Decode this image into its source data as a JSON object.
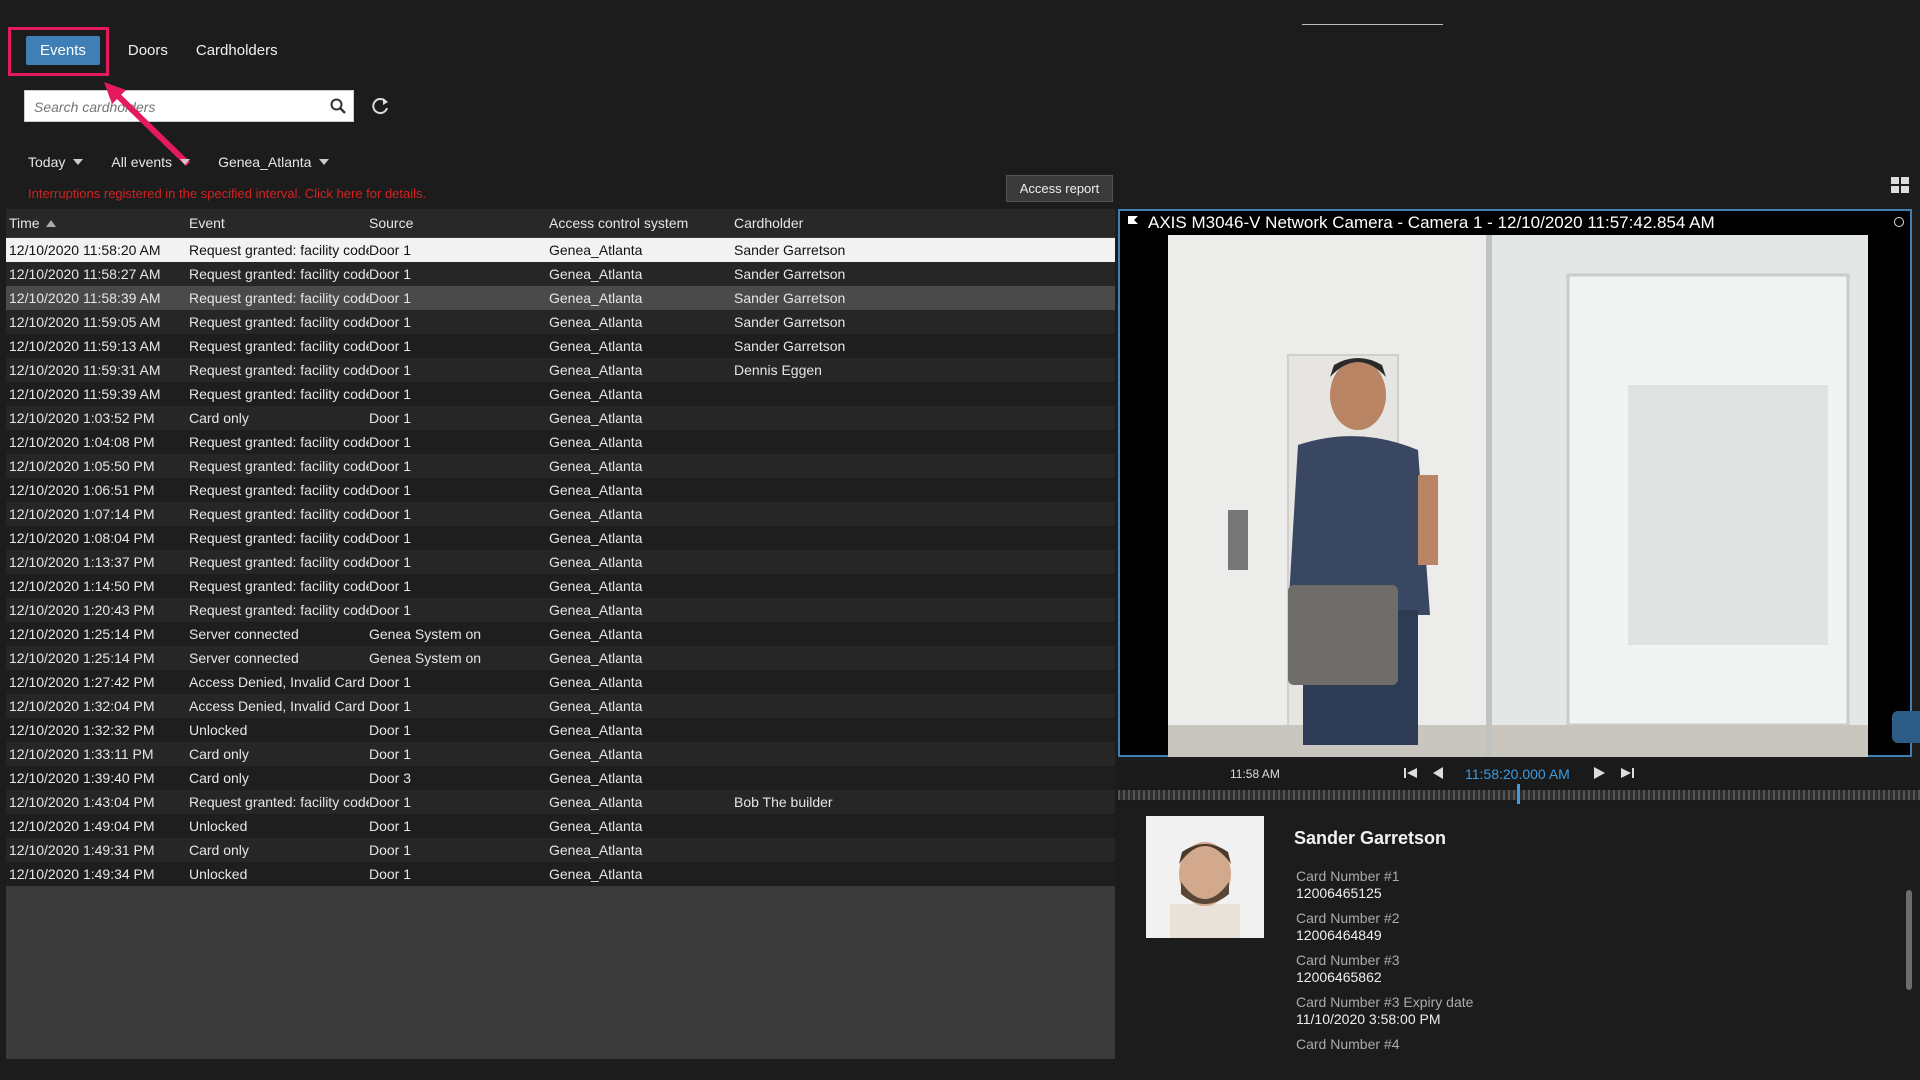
{
  "tabs": [
    {
      "label": "Events",
      "active": true
    },
    {
      "label": "Doors",
      "active": false
    },
    {
      "label": "Cardholders",
      "active": false
    }
  ],
  "search": {
    "placeholder": "Search cardholders",
    "value": ""
  },
  "filters": {
    "period": "Today",
    "events": "All events",
    "system": "Genea_Atlanta"
  },
  "warning": "Interruptions registered in the specified interval. Click here for details.",
  "access_report_label": "Access report",
  "table": {
    "columns": [
      "Time",
      "Event",
      "Source",
      "Access control system",
      "Cardholder"
    ],
    "rows": [
      [
        "12/10/2020 11:58:20 AM",
        "Request granted: facility code",
        "Door 1",
        "Genea_Atlanta",
        "Sander Garretson"
      ],
      [
        "12/10/2020 11:58:27 AM",
        "Request granted: facility code",
        "Door 1",
        "Genea_Atlanta",
        "Sander Garretson"
      ],
      [
        "12/10/2020 11:58:39 AM",
        "Request granted: facility code",
        "Door 1",
        "Genea_Atlanta",
        "Sander Garretson"
      ],
      [
        "12/10/2020 11:59:05 AM",
        "Request granted: facility code",
        "Door 1",
        "Genea_Atlanta",
        "Sander Garretson"
      ],
      [
        "12/10/2020 11:59:13 AM",
        "Request granted: facility code",
        "Door 1",
        "Genea_Atlanta",
        "Sander Garretson"
      ],
      [
        "12/10/2020 11:59:31 AM",
        "Request granted: facility code",
        "Door 1",
        "Genea_Atlanta",
        "Dennis Eggen"
      ],
      [
        "12/10/2020 11:59:39 AM",
        "Request granted: facility code",
        "Door 1",
        "Genea_Atlanta",
        ""
      ],
      [
        "12/10/2020 1:03:52 PM",
        "Card only",
        "Door 1",
        "Genea_Atlanta",
        ""
      ],
      [
        "12/10/2020 1:04:08 PM",
        "Request granted: facility code",
        "Door 1",
        "Genea_Atlanta",
        ""
      ],
      [
        "12/10/2020 1:05:50 PM",
        "Request granted: facility code",
        "Door 1",
        "Genea_Atlanta",
        ""
      ],
      [
        "12/10/2020 1:06:51 PM",
        "Request granted: facility code",
        "Door 1",
        "Genea_Atlanta",
        ""
      ],
      [
        "12/10/2020 1:07:14 PM",
        "Request granted: facility code",
        "Door 1",
        "Genea_Atlanta",
        ""
      ],
      [
        "12/10/2020 1:08:04 PM",
        "Request granted: facility code",
        "Door 1",
        "Genea_Atlanta",
        ""
      ],
      [
        "12/10/2020 1:13:37 PM",
        "Request granted: facility code",
        "Door 1",
        "Genea_Atlanta",
        ""
      ],
      [
        "12/10/2020 1:14:50 PM",
        "Request granted: facility code",
        "Door 1",
        "Genea_Atlanta",
        ""
      ],
      [
        "12/10/2020 1:20:43 PM",
        "Request granted: facility code",
        "Door 1",
        "Genea_Atlanta",
        ""
      ],
      [
        "12/10/2020 1:25:14 PM",
        "Server connected",
        "Genea System on",
        "Genea_Atlanta",
        ""
      ],
      [
        "12/10/2020 1:25:14 PM",
        "Server connected",
        "Genea System on",
        "Genea_Atlanta",
        ""
      ],
      [
        "12/10/2020 1:27:42 PM",
        "Access Denied, Invalid Card",
        "Door 1",
        "Genea_Atlanta",
        ""
      ],
      [
        "12/10/2020 1:32:04 PM",
        "Access Denied, Invalid Card",
        "Door 1",
        "Genea_Atlanta",
        ""
      ],
      [
        "12/10/2020 1:32:32 PM",
        "Unlocked",
        "Door 1",
        "Genea_Atlanta",
        ""
      ],
      [
        "12/10/2020 1:33:11 PM",
        "Card only",
        "Door 1",
        "Genea_Atlanta",
        ""
      ],
      [
        "12/10/2020 1:39:40 PM",
        "Card only",
        "Door 3",
        "Genea_Atlanta",
        ""
      ],
      [
        "12/10/2020 1:43:04 PM",
        "Request granted: facility code",
        "Door 1",
        "Genea_Atlanta",
        "Bob The builder"
      ],
      [
        "12/10/2020 1:49:04 PM",
        "Unlocked",
        "Door 1",
        "Genea_Atlanta",
        ""
      ],
      [
        "12/10/2020 1:49:31 PM",
        "Card only",
        "Door 1",
        "Genea_Atlanta",
        ""
      ],
      [
        "12/10/2020 1:49:34 PM",
        "Unlocked",
        "Door 1",
        "Genea_Atlanta",
        ""
      ]
    ]
  },
  "camera": {
    "title": "AXIS M3046-V Network Camera - Camera 1 - 12/10/2020 11:57:42.854 AM"
  },
  "timeline": {
    "left_label": "11:58 AM",
    "current_time": "11:58:20.000 AM"
  },
  "cardholder": {
    "name": "Sander Garretson",
    "fields": [
      {
        "label": "Card Number #1",
        "value": "12006465125"
      },
      {
        "label": "Card Number #2",
        "value": "12006464849"
      },
      {
        "label": "Card Number #3",
        "value": "12006465862"
      },
      {
        "label": "Card Number #3 Expiry date",
        "value": "11/10/2020 3:58:00 PM"
      },
      {
        "label": "Card Number #4",
        "value": ""
      }
    ]
  },
  "colors": {
    "accent": "#3f7fb6",
    "highlight": "#e5195f",
    "warning": "#d62020"
  },
  "icons": [
    "search-icon",
    "refresh-icon",
    "sort-asc-icon",
    "layout-icon",
    "camera-flag-icon",
    "skip-back-icon",
    "step-back-icon",
    "play-icon",
    "skip-forward-icon"
  ]
}
